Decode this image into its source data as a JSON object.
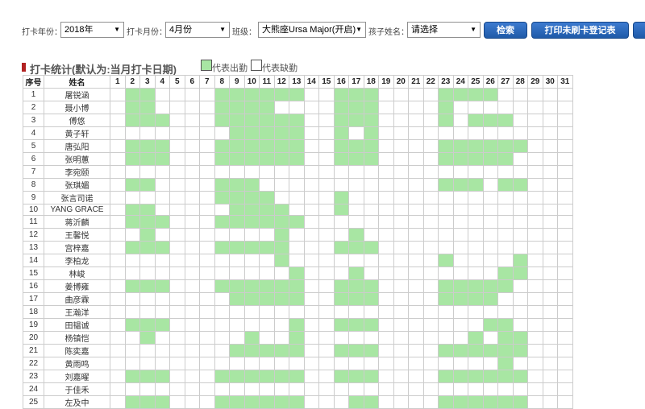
{
  "filters": {
    "year_label": "打卡年份：",
    "year_value": "2018年",
    "month_label": "打卡月份：",
    "month_value": "4月份",
    "class_label": "班级：",
    "class_value": "大熊座Ursa Major(开启)",
    "child_label": "孩子姓名：",
    "child_value": "请选择",
    "dropdown_icon": "triangle-down-icon"
  },
  "buttons": {
    "search": "检索",
    "print": "打印未刷卡登记表"
  },
  "section": {
    "title": "打卡统计(默认为:当月打卡日期)",
    "legend_present": "代表出勤",
    "legend_absent": "代表缺勤"
  },
  "colors": {
    "present": "#a8e6a3",
    "button": "#2a66b8",
    "title_bar": "#b22222"
  },
  "table": {
    "col_index": "序号",
    "col_name": "姓名",
    "days": [
      "1",
      "2",
      "3",
      "4",
      "5",
      "6",
      "7",
      "8",
      "9",
      "10",
      "11",
      "12",
      "13",
      "14",
      "15",
      "16",
      "17",
      "18",
      "19",
      "20",
      "21",
      "22",
      "23",
      "24",
      "25",
      "26",
      "27",
      "28",
      "29",
      "30",
      "31"
    ],
    "rows": [
      {
        "no": "1",
        "name": "屠锐涵",
        "present": [
          2,
          3,
          8,
          9,
          10,
          11,
          12,
          13,
          16,
          17,
          18,
          23,
          24,
          25,
          26
        ]
      },
      {
        "no": "2",
        "name": "聂小博",
        "present": [
          2,
          3,
          8,
          9,
          10,
          11,
          16,
          17,
          18,
          23
        ]
      },
      {
        "no": "3",
        "name": "傅悠",
        "present": [
          2,
          3,
          4,
          8,
          9,
          10,
          11,
          12,
          13,
          16,
          17,
          18,
          23,
          25,
          26,
          27
        ]
      },
      {
        "no": "4",
        "name": "黄子轩",
        "present": [
          9,
          10,
          11,
          12,
          13,
          16,
          18
        ]
      },
      {
        "no": "5",
        "name": "唐弘阳",
        "present": [
          2,
          3,
          4,
          8,
          9,
          10,
          11,
          12,
          13,
          16,
          17,
          18,
          23,
          24,
          25,
          26,
          27,
          28
        ]
      },
      {
        "no": "6",
        "name": "张明蕙",
        "present": [
          2,
          3,
          4,
          8,
          9,
          10,
          11,
          12,
          13,
          16,
          17,
          18,
          23,
          24,
          25,
          26,
          27
        ]
      },
      {
        "no": "7",
        "name": "李宛颐",
        "present": []
      },
      {
        "no": "8",
        "name": "张琪媚",
        "present": [
          2,
          3,
          8,
          9,
          10,
          23,
          24,
          25,
          27,
          28
        ]
      },
      {
        "no": "9",
        "name": "张言司诺",
        "present": [
          8,
          9,
          10,
          11,
          16
        ]
      },
      {
        "no": "10",
        "name": "YANG GRACE",
        "present": [
          2,
          3,
          9,
          10,
          11,
          12,
          16
        ]
      },
      {
        "no": "11",
        "name": "蒋沂麟",
        "present": [
          2,
          3,
          4,
          8,
          9,
          10,
          11,
          12,
          13
        ]
      },
      {
        "no": "12",
        "name": "王馨悦",
        "present": [
          3,
          12,
          17
        ]
      },
      {
        "no": "13",
        "name": "宫梓嘉",
        "present": [
          2,
          3,
          4,
          8,
          9,
          10,
          11,
          12,
          16,
          17,
          18
        ]
      },
      {
        "no": "14",
        "name": "李柏龙",
        "present": [
          12,
          23,
          28
        ]
      },
      {
        "no": "15",
        "name": "林峻",
        "present": [
          13,
          17,
          27,
          28
        ]
      },
      {
        "no": "16",
        "name": "姜博雍",
        "present": [
          2,
          3,
          4,
          8,
          9,
          10,
          11,
          12,
          13,
          16,
          17,
          18,
          23,
          24,
          25,
          26,
          27
        ]
      },
      {
        "no": "17",
        "name": "曲彦霖",
        "present": [
          9,
          10,
          11,
          12,
          13,
          16,
          17,
          18,
          23,
          24,
          25,
          26
        ]
      },
      {
        "no": "18",
        "name": "王瀚洋",
        "present": []
      },
      {
        "no": "19",
        "name": "田韫诚",
        "present": [
          2,
          3,
          4,
          13,
          16,
          17,
          18,
          26,
          27
        ]
      },
      {
        "no": "20",
        "name": "杨镇恺",
        "present": [
          3,
          10,
          13,
          25,
          27,
          28
        ]
      },
      {
        "no": "21",
        "name": "陈奕嘉",
        "present": [
          9,
          10,
          11,
          12,
          13,
          16,
          17,
          18,
          23,
          24,
          25,
          26,
          27,
          28
        ]
      },
      {
        "no": "22",
        "name": "黄雨鸣",
        "present": [
          27
        ]
      },
      {
        "no": "23",
        "name": "刘嘉曜",
        "present": [
          2,
          3,
          4,
          8,
          9,
          10,
          11,
          12,
          13,
          16,
          17,
          18,
          23,
          24,
          25,
          26,
          27,
          28
        ]
      },
      {
        "no": "24",
        "name": "于佳禾",
        "present": []
      },
      {
        "no": "25",
        "name": "左及中",
        "present": [
          2,
          3,
          4,
          8,
          9,
          10,
          11,
          12,
          13,
          17,
          18,
          23,
          24,
          25,
          26,
          27,
          28
        ]
      }
    ]
  }
}
